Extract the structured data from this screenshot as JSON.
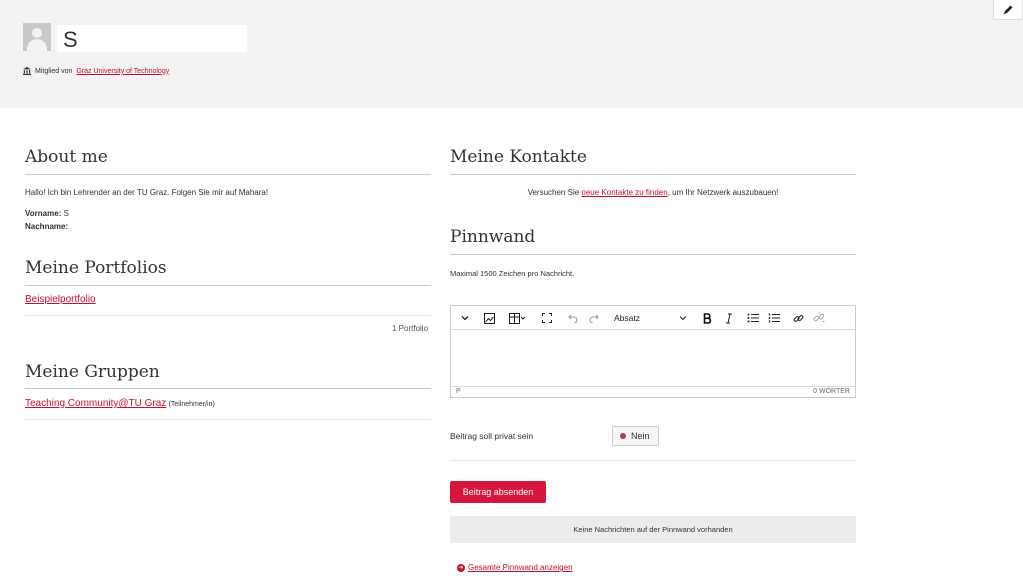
{
  "profile": {
    "name": "S",
    "member_prefix": "Mitglied von",
    "institution": "Graz University of Technology"
  },
  "about": {
    "title": "About me",
    "intro": "Hallo! Ich bin Lehrender an der TU Graz. Folgen Sie mir auf Mahara!",
    "firstname_label": "Vorname:",
    "firstname_value": "S",
    "lastname_label": "Nachname:"
  },
  "portfolios": {
    "title": "Meine Portfolios",
    "items": [
      "Beispielportfolio"
    ],
    "count": "1 Portfolio"
  },
  "groups": {
    "title": "Meine Gruppen",
    "items": [
      {
        "name": "Teaching Community@TU Graz",
        "role": "(Teilnehmer/in)"
      }
    ]
  },
  "contacts": {
    "title": "Meine Kontakte",
    "before": "Versuchen Sie ",
    "link": "neue Kontakte zu finden",
    "after": ", um Ihr Netzwerk auszubauen!"
  },
  "wall": {
    "title": "Pinnwand",
    "hint": "Maximal 1500 Zeichen pro Nachricht.",
    "editor": {
      "format_label": "Absatz",
      "path": "P",
      "wordcount": "0 WÖRTER"
    },
    "private_label": "Beitrag soll privat sein",
    "private_value": "Nein",
    "submit_label": "Beitrag absenden",
    "empty_message": "Keine Nachrichten auf der Pinnwand vorhanden",
    "show_all": "Gesamte Pinnwand anzeigen"
  },
  "colors": {
    "accent": "#c8102e",
    "button": "#d5173d",
    "header_bg": "#f3f3f3"
  }
}
